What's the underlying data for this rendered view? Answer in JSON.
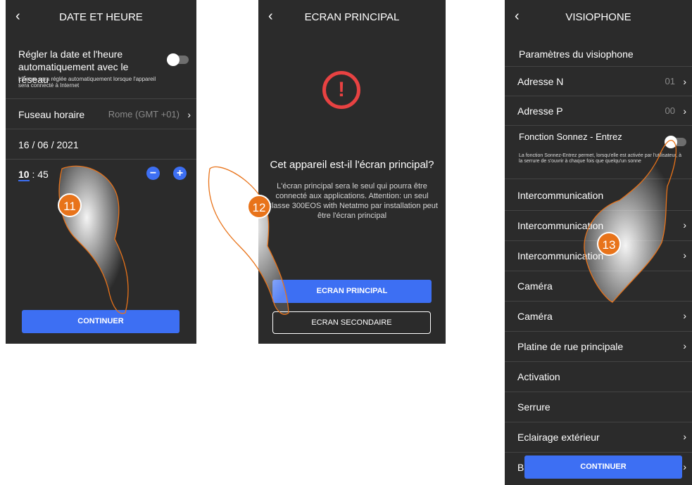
{
  "screen1": {
    "title": "DATE ET HEURE",
    "auto_label": "Régler la date et l'heure automatiquement avec le réseau",
    "auto_note": "L'heure sera réglée automatiquement lorsque l'appareil sera connecté à Internet",
    "timezone_label": "Fuseau horaire",
    "timezone_value": "Rome (GMT +01)",
    "date": "16 / 06 / 2021",
    "time_hours": "10",
    "time_sep": ":",
    "time_minutes": "45",
    "minus": "−",
    "plus": "+",
    "continue_label": "CONTINUER",
    "step": "11"
  },
  "screen2": {
    "title": "ECRAN PRINCIPAL",
    "question": "Cet appareil est-il l'écran principal?",
    "description": "L'écran principal sera le seul qui pourra être connecté aux applications. Attention: un seul Classe 300EOS with Netatmo par installation peut être l'écran principal",
    "primary_button": "ECRAN PRINCIPAL",
    "secondary_button": "ECRAN SECONDAIRE",
    "step": "12"
  },
  "screen3": {
    "title": "VISIOPHONE",
    "section": "Paramètres du visiophone",
    "adresse_n_label": "Adresse N",
    "adresse_n_value": "01",
    "adresse_p_label": "Adresse P",
    "adresse_p_value": "00",
    "sonnez_label": "Fonction Sonnez - Entrez",
    "sonnez_note": "La fonction Sonnez-Entrez permet, lorsqu'elle est activée par l'utilisateur, à la serrure de s'ouvrir à chaque fois que quelqu'un sonne",
    "items": [
      {
        "label": "Intercommunication",
        "chevron": false
      },
      {
        "label": "Intercommunication",
        "chevron": true
      },
      {
        "label": "Intercommunication",
        "chevron": true
      },
      {
        "label": "Caméra",
        "chevron": false
      },
      {
        "label": "Caméra",
        "chevron": true
      },
      {
        "label": "Platine de rue principale",
        "chevron": true
      },
      {
        "label": "Activation",
        "chevron": false
      },
      {
        "label": "Serrure",
        "chevron": false
      },
      {
        "label": "Eclairage extérieur",
        "chevron": true
      }
    ],
    "partial_item": "B",
    "continue_label": "CONTINUER",
    "step": "13"
  },
  "colors": {
    "screen_bg": "#2b2b2b",
    "accent": "#3d6ff3",
    "alert": "#e84242",
    "badge": "#e8731a"
  },
  "icons": [
    "back-chevron-icon",
    "chevron-right-icon",
    "alert-icon",
    "minus-icon",
    "plus-icon",
    "hand-pointer-icon"
  ]
}
